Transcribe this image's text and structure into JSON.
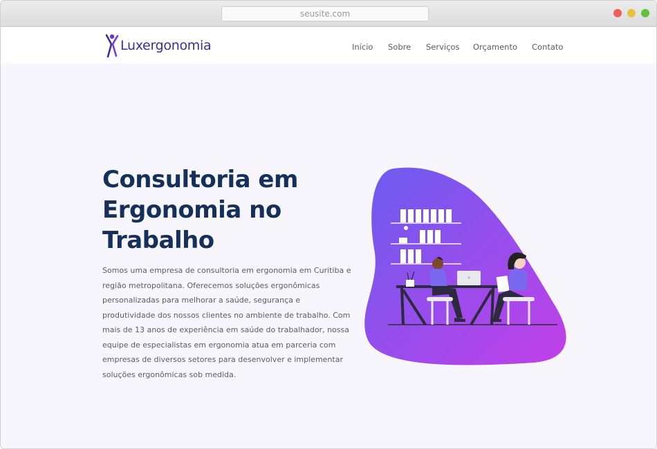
{
  "browser": {
    "url": "seusite.com"
  },
  "brand": {
    "name": "Luxergonomia",
    "accent": "#3d2f95",
    "logo_icon": "person-stretching-icon"
  },
  "nav": {
    "items": [
      {
        "label": "Início"
      },
      {
        "label": "Sobre"
      },
      {
        "label": "Serviços"
      },
      {
        "label": "Orçamento"
      },
      {
        "label": "Contato"
      }
    ]
  },
  "hero": {
    "title_line1": "Consultoria em",
    "title_line2": "Ergonomia no",
    "title_line3": "Trabalho",
    "text": "Somos uma empresa de consultoria em ergonomia em Curitiba e região metropolitana. Oferecemos soluções ergonômicas personalizadas para melhorar a saúde, segurança e produtividade dos nossos clientes no ambiente de trabalho. Com mais de 13 anos de experiência em saúde do trabalhador, nossa equipe de especialistas em ergonomia atua em parceria com empresas de diversos setores para desenvolver e implementar soluções ergonômicas sob medida.",
    "title_color": "#15305a",
    "blob_gradient": [
      "#6a5cf0",
      "#c23fe8"
    ],
    "illustration": "two-people-working-at-table-illustration"
  }
}
